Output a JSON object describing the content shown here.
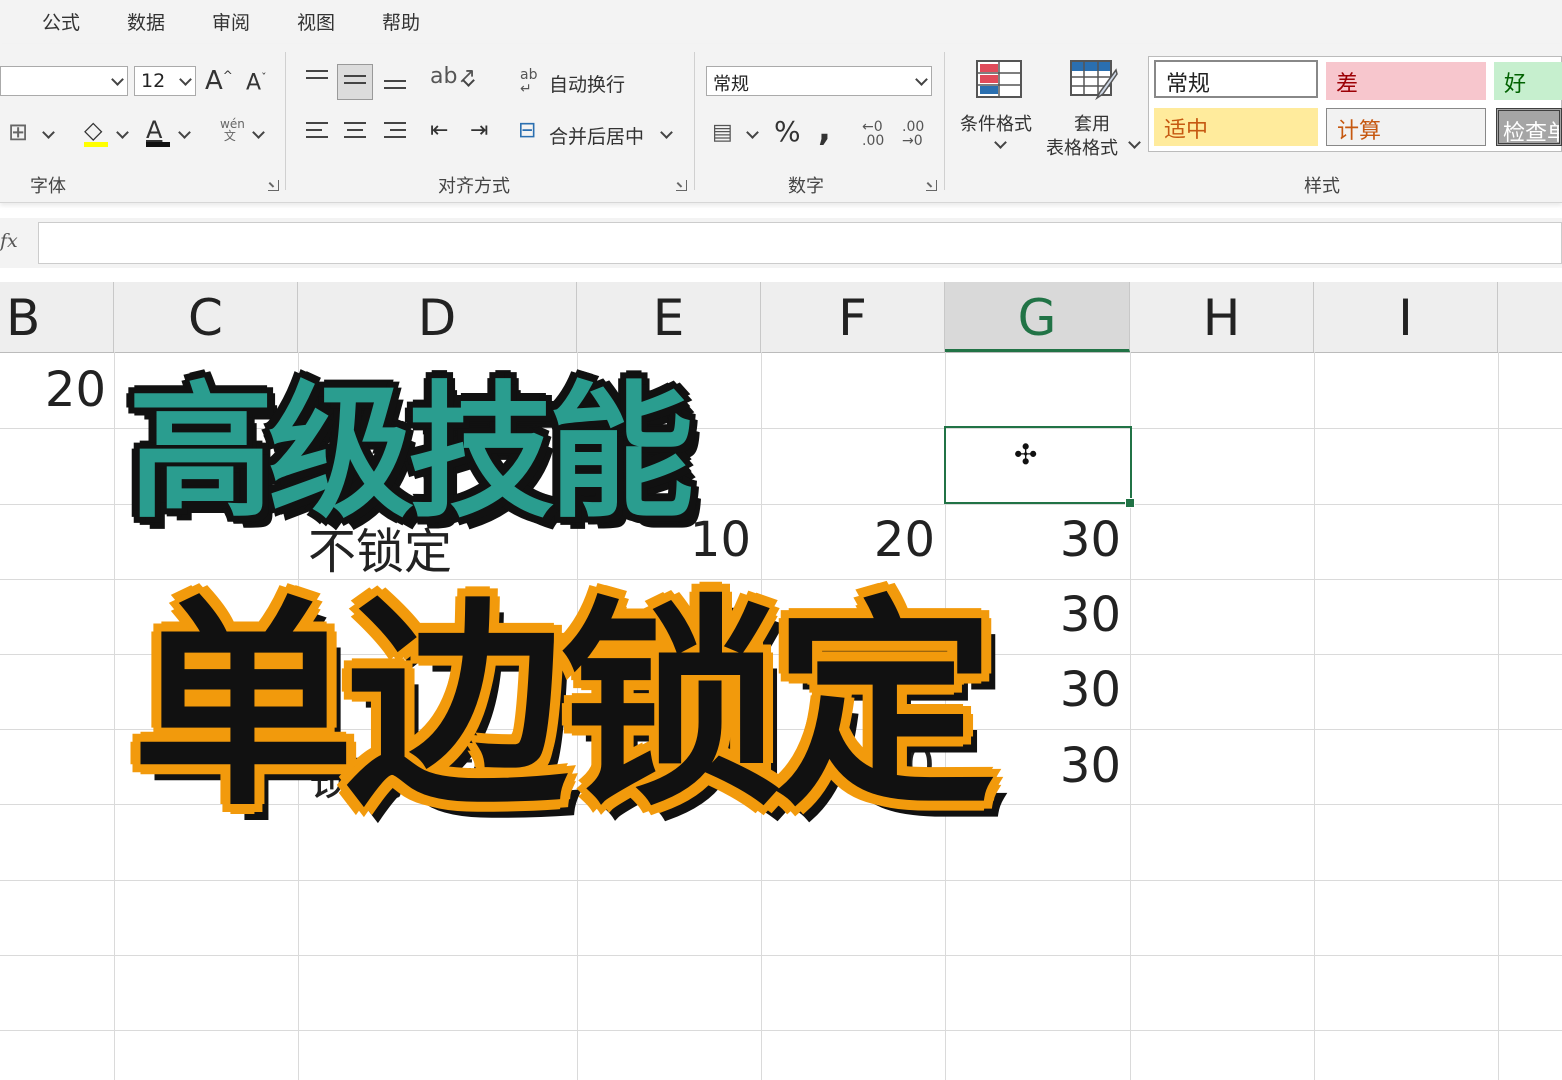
{
  "menu": {
    "tabs": [
      "公式",
      "数据",
      "审阅",
      "视图",
      "帮助"
    ]
  },
  "ribbon": {
    "font": {
      "label": "字体",
      "size": "12"
    },
    "align": {
      "label": "对齐方式",
      "wrap_text": "自动换行",
      "merge_center": "合并后居中"
    },
    "number": {
      "label": "数字",
      "format": "常规",
      "percent": "%",
      "comma": ","
    },
    "styles": {
      "label": "样式",
      "conditional_format": "条件格式",
      "table_format_line1": "套用",
      "table_format_line2": "表格格式",
      "normal": "常规",
      "bad": "差",
      "good": "好",
      "neutral": "适中",
      "calc": "计算",
      "check": "检查单"
    }
  },
  "formula_bar": {
    "fx": "fx",
    "value": ""
  },
  "columns": [
    "B",
    "C",
    "D",
    "E",
    "F",
    "G",
    "H",
    "I"
  ],
  "selected_column": "G",
  "cells": {
    "b1": "20",
    "d3": "不锁定",
    "e3": "10",
    "f3": "20",
    "g3": "30",
    "g4": "30",
    "g5": "30",
    "d6": "锁列不锁行",
    "e6": "10",
    "f6": "20",
    "g6": "30"
  },
  "overlay": {
    "line1": "高级技能",
    "line2": "单边锁定"
  },
  "colors": {
    "excel_green": "#217346",
    "teal": "#2a9d8f",
    "orange": "#f29a0c"
  }
}
